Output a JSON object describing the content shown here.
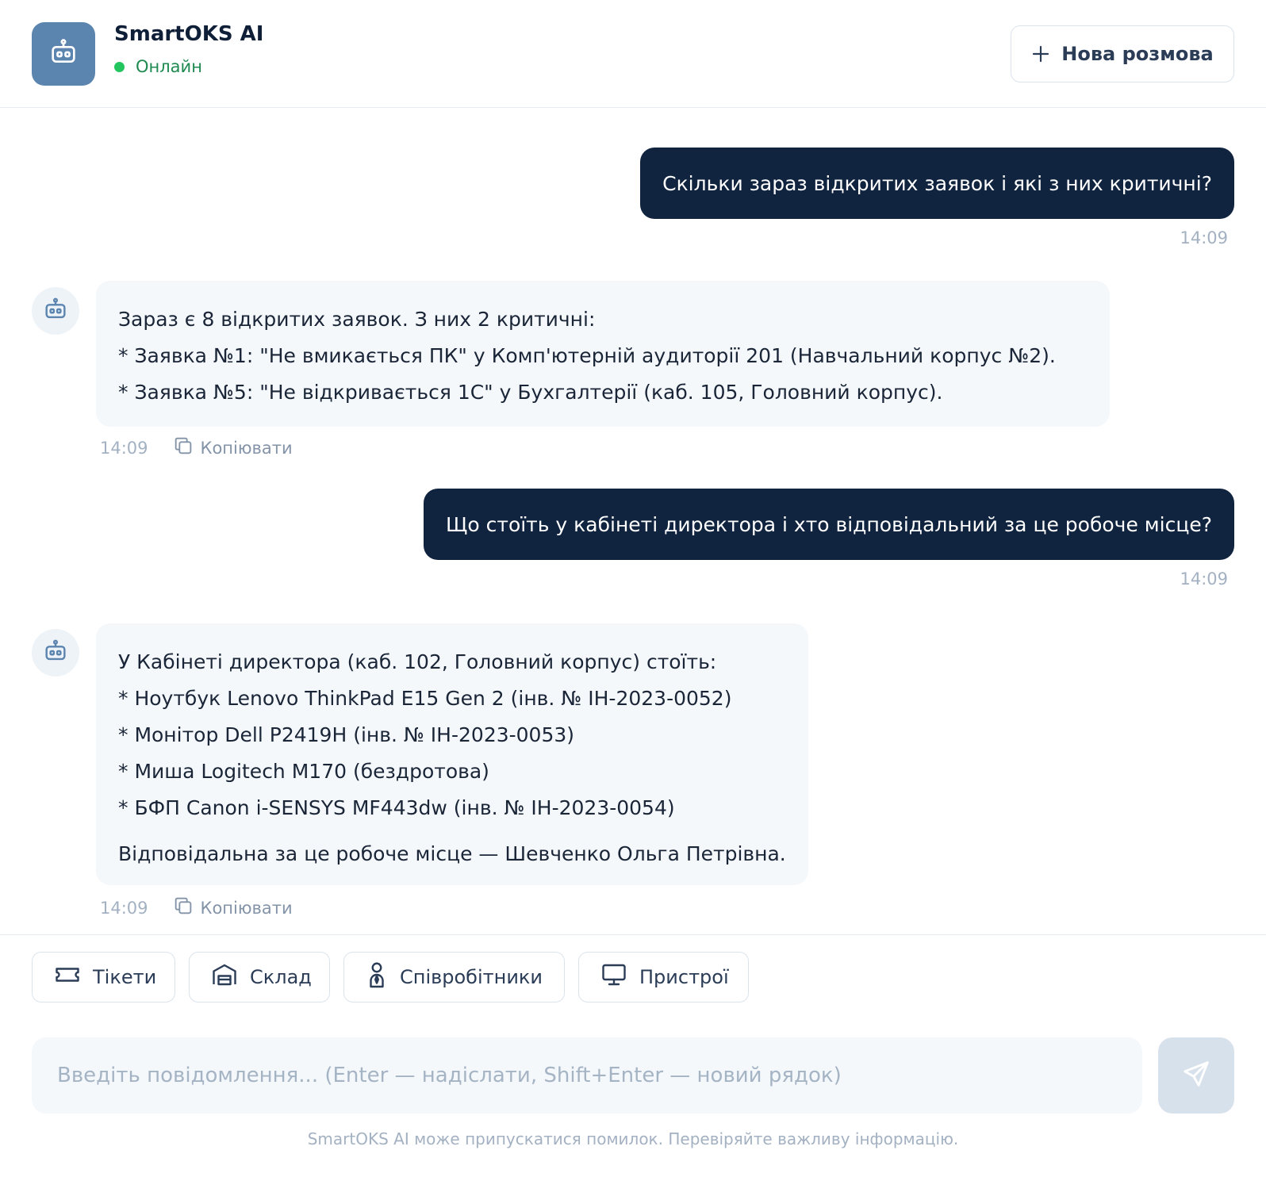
{
  "header": {
    "title": "SmartOKS AI",
    "status": "Онлайн",
    "new_chat_label": "Нова розмова"
  },
  "messages": [
    {
      "role": "user",
      "text": "Скільки зараз відкритих заявок і які з них критичні?",
      "time": "14:09"
    },
    {
      "role": "bot",
      "lines": [
        "Зараз є 8 відкритих заявок. З них 2 критичні:",
        "* Заявка №1: \"Не вмикається ПК\" у Комп'ютерній аудиторії 201 (Навчальний корпус №2).",
        "* Заявка №5: \"Не відкривається 1С\" у Бухгалтерії (каб. 105, Головний корпус)."
      ],
      "time": "14:09",
      "copy_label": "Копіювати"
    },
    {
      "role": "user",
      "text": "Що стоїть у кабінеті директора і хто відповідальний за це робоче місце?",
      "time": "14:09"
    },
    {
      "role": "bot",
      "lines": [
        "У Кабінеті директора (каб. 102, Головний корпус) стоїть:",
        "* Ноутбук Lenovo ThinkPad E15 Gen 2 (інв. № ІН-2023-0052)",
        "* Монітор Dell P2419H (інв. № ІН-2023-0053)",
        "* Миша Logitech M170 (бездротова)",
        "* БФП Canon i-SENSYS MF443dw (інв. № ІН-2023-0054)",
        "Відповідальна за це робоче місце — Шевченко Ольга Петрівна."
      ],
      "time": "14:09",
      "copy_label": "Копіювати"
    }
  ],
  "quick_actions": [
    {
      "label": "Тікети",
      "icon": "ticket-icon"
    },
    {
      "label": "Склад",
      "icon": "warehouse-icon"
    },
    {
      "label": "Співробітники",
      "icon": "person-icon"
    },
    {
      "label": "Пристрої",
      "icon": "monitor-icon"
    }
  ],
  "composer": {
    "placeholder": "Введіть повідомлення... (Enter — надіслати, Shift+Enter — новий рядок)",
    "value": ""
  },
  "disclaimer": "SmartOKS AI може припускатися помилок. Перевіряйте важливу інформацію.",
  "colors": {
    "brand": "#5b84af",
    "user_bubble": "#10233f",
    "bot_bubble": "#f5f8fb",
    "online": "#22c55e"
  }
}
